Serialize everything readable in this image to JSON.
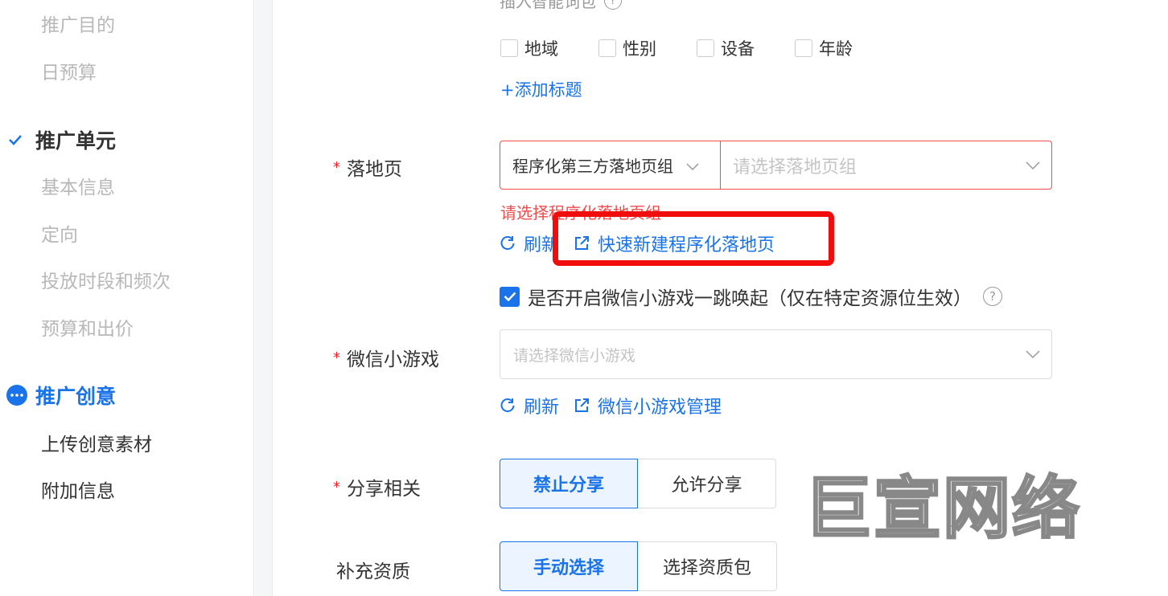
{
  "sidebar": {
    "items_top": [
      {
        "label": "推广目的"
      },
      {
        "label": "日预算"
      }
    ],
    "unit_section": {
      "label": "推广单元",
      "icon": "check-icon",
      "color": "#333333"
    },
    "unit_items": [
      {
        "label": "基本信息"
      },
      {
        "label": "定向"
      },
      {
        "label": "投放时段和频次"
      },
      {
        "label": "预算和出价"
      }
    ],
    "creative_section": {
      "label": "推广创意",
      "icon": "more-dots-icon",
      "color": "#1a73e8"
    },
    "creative_items": [
      {
        "label": "上传创意素材"
      },
      {
        "label": "附加信息"
      }
    ]
  },
  "main": {
    "smart_words": {
      "label": "插入智能词包",
      "icon": "question-icon"
    },
    "checkboxes": [
      {
        "label": "地域",
        "checked": false
      },
      {
        "label": "性别",
        "checked": false
      },
      {
        "label": "设备",
        "checked": false
      },
      {
        "label": "年龄",
        "checked": false
      }
    ],
    "add_title": "+添加标题",
    "landing_page": {
      "required": "*",
      "label": "落地页",
      "type_select": "程序化第三方落地页组",
      "group_placeholder": "请选择落地页组",
      "error": "请选择程序化落地页组",
      "refresh": "刷新",
      "quick_create": "快速新建程序化落地页"
    },
    "wechat_toggle": {
      "label": "是否开启微信小游戏一跳唤起（仅在特定资源位生效）",
      "checked": true
    },
    "wechat_game": {
      "required": "*",
      "label": "微信小游戏",
      "placeholder": "请选择微信小游戏",
      "refresh": "刷新",
      "manage": "微信小游戏管理"
    },
    "share": {
      "required": "*",
      "label": "分享相关",
      "options": [
        "禁止分享",
        "允许分享"
      ],
      "selected": "禁止分享"
    },
    "qualification": {
      "label": "补充资质",
      "options": [
        "手动选择",
        "选择资质包"
      ],
      "selected": "手动选择"
    }
  },
  "watermark": {
    "text": "巨宣网络"
  },
  "colors": {
    "accent": "#1a73e8",
    "error": "#f04c4c",
    "highlight": "#f20d0d"
  }
}
